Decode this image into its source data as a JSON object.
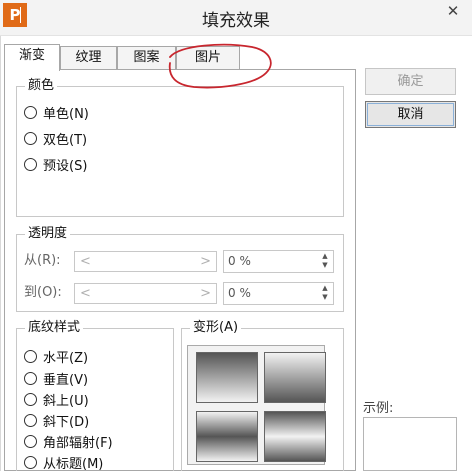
{
  "window": {
    "title": "填充效果",
    "app_icon_letter": "P",
    "close_glyph": "✕"
  },
  "tabs": [
    {
      "label": "渐变",
      "active": true
    },
    {
      "label": "纹理",
      "active": false
    },
    {
      "label": "图案",
      "active": false
    },
    {
      "label": "图片",
      "active": false
    }
  ],
  "color_group": {
    "title": "颜色",
    "options": [
      {
        "label": "单色(N)",
        "selected": false
      },
      {
        "label": "双色(T)",
        "selected": false
      },
      {
        "label": "预设(S)",
        "selected": false
      }
    ]
  },
  "transparency_group": {
    "title": "透明度",
    "from_label": "从(R):",
    "from_value": "0 %",
    "to_label": "到(O):",
    "to_value": "0 %",
    "slider_left_glyph": "<",
    "slider_right_glyph": ">"
  },
  "shading_group": {
    "title": "底纹样式",
    "options": [
      {
        "label": "水平(Z)"
      },
      {
        "label": "垂直(V)"
      },
      {
        "label": "斜上(U)"
      },
      {
        "label": "斜下(D)"
      },
      {
        "label": "角部辐射(F)"
      },
      {
        "label": "从标题(M)"
      }
    ]
  },
  "variants_group": {
    "title": "变形(A)"
  },
  "buttons": {
    "ok_label": "确定",
    "cancel_label": "取消"
  },
  "sample_label": "示例:",
  "colors": {
    "app_icon": "#e06a17",
    "annotation": "#c8262e",
    "focus": "#8ab0d8"
  }
}
